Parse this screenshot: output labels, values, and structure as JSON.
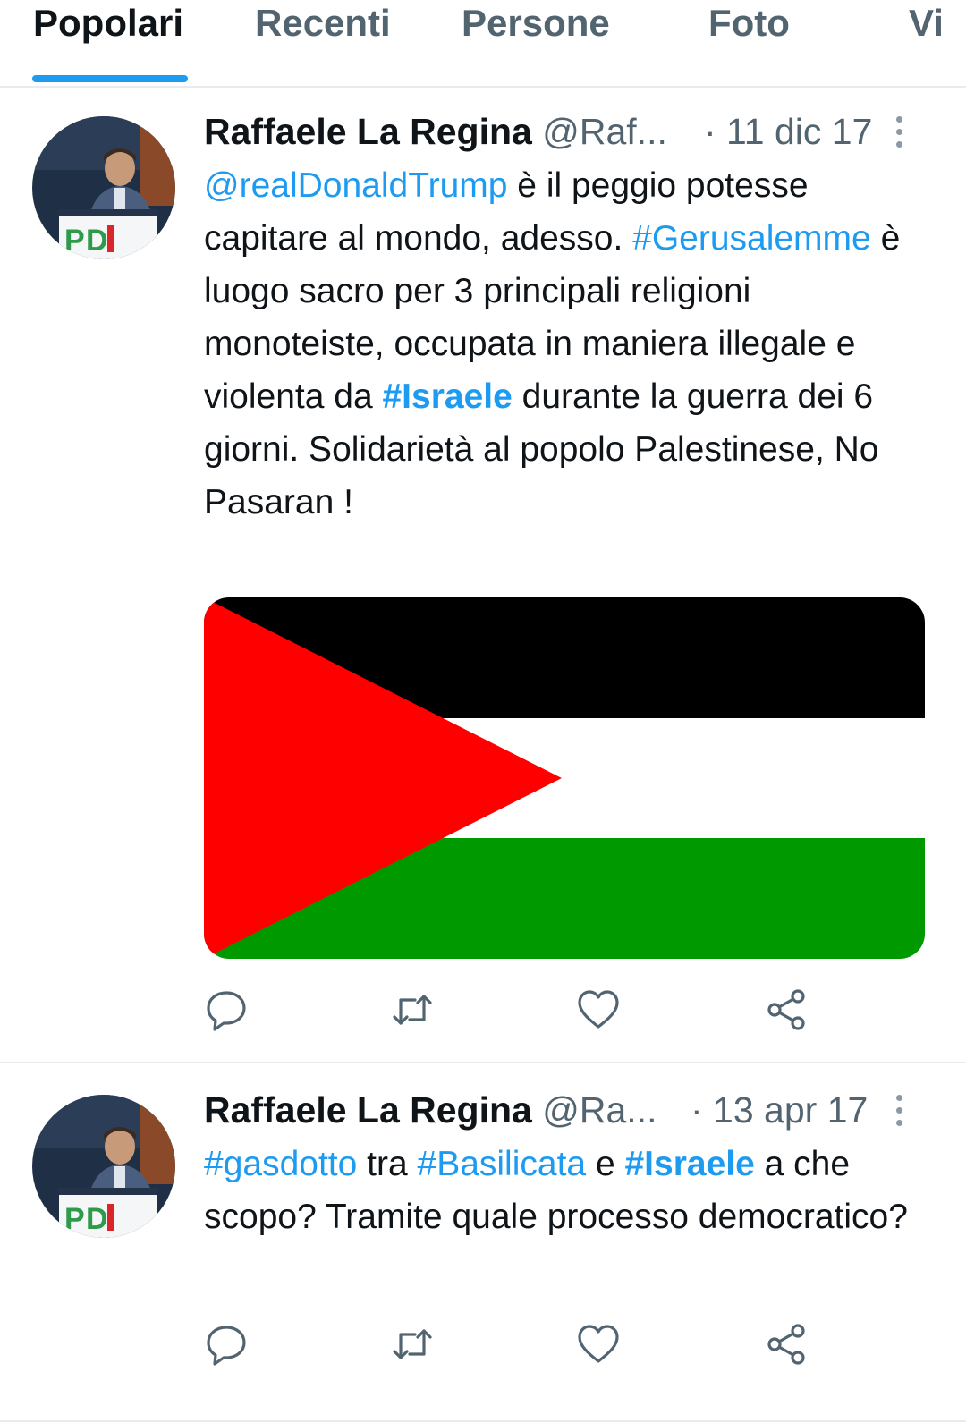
{
  "tabs": [
    {
      "label": "Popolari"
    },
    {
      "label": "Recenti"
    },
    {
      "label": "Persone"
    },
    {
      "label": "Foto"
    },
    {
      "label": "Vi"
    }
  ],
  "accent_color": "#1d9bf0",
  "tweets": [
    {
      "author_name": "Raffaele La Regina",
      "handle": "@Raf...",
      "date": "· 11 dic 17",
      "text": {
        "mention": "@realDonaldTrump",
        "p1": " è il peggio potesse capitare al mondo, adesso. ",
        "tag1": "#Gerusalemme",
        "p2": " è luogo sacro per 3 principali religioni monoteiste, occupata in maniera illegale e violenta da ",
        "tag2": "#Israele",
        "p3": " durante la guerra dei 6 giorni. Solidarietà al popolo Palestinese, No Pasaran !"
      },
      "media": "palestine-flag-image",
      "actions": [
        "reply-icon",
        "retweet-icon",
        "like-icon",
        "share-icon"
      ]
    },
    {
      "author_name": "Raffaele La Regina",
      "handle": "@Ra...",
      "date": "· 13 apr 17",
      "text": {
        "tag1": "#gasdotto",
        "p1": " tra ",
        "tag2": "#Basilicata",
        "p2": " e ",
        "tag3": "#Israele",
        "p3": " a che scopo? Tramite quale processo democratico?"
      },
      "actions": [
        "reply-icon",
        "retweet-icon",
        "like-icon",
        "share-icon"
      ]
    }
  ]
}
